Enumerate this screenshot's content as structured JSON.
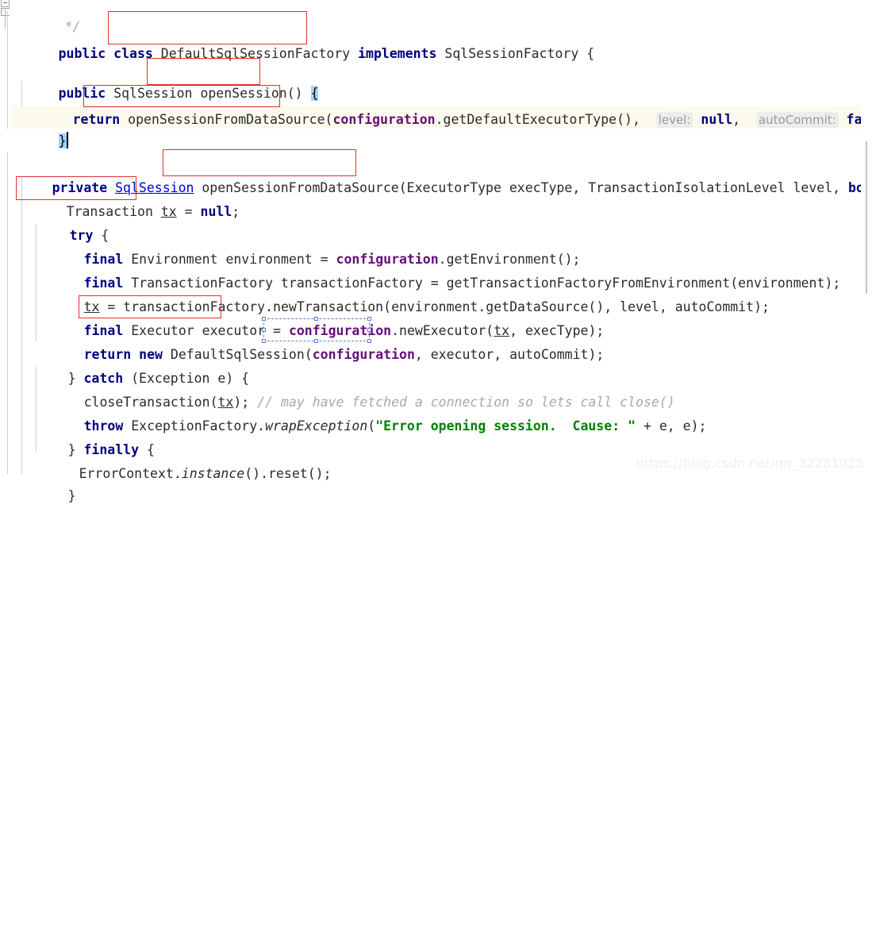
{
  "editor": {
    "language": "java",
    "colors": {
      "keyword": "#000080",
      "field": "#660e7a",
      "string": "#008000",
      "comment": "#a8a8a8",
      "link": "#0000d0",
      "annotation_box": "#e03030",
      "selection_box": "#5b7ed6",
      "text_selection": "#a6d2ff",
      "current_line": "#fcfaec",
      "hint_background": "#ededed",
      "hint_text": "#9a9a9a",
      "watermark": "#efefef",
      "background": "#ffffff"
    },
    "lines": [
      {
        "id": "l1",
        "text": "  */"
      },
      {
        "id": "l2",
        "text": "public class DefaultSqlSessionFactory implements SqlSessionFactory {"
      },
      {
        "id": "l3",
        "text": ""
      },
      {
        "id": "l4",
        "text": "public SqlSession openSession() {"
      },
      {
        "id": "l5",
        "text": "  return openSessionFromDataSource(configuration.getDefaultExecutorType(), level: null, autoCommit: false);"
      },
      {
        "id": "l6",
        "text": "}"
      },
      {
        "id": "l7",
        "text": ""
      },
      {
        "id": "l8",
        "text": "private SqlSession openSessionFromDataSource(ExecutorType execType, TransactionIsolationLevel level, boolean"
      },
      {
        "id": "l9",
        "text": "  Transaction tx = null;"
      },
      {
        "id": "l10",
        "text": "  try {"
      },
      {
        "id": "l11",
        "text": "    final Environment environment = configuration.getEnvironment();"
      },
      {
        "id": "l12",
        "text": "    final TransactionFactory transactionFactory = getTransactionFactoryFromEnvironment(environment);"
      },
      {
        "id": "l13",
        "text": "    tx = transactionFactory.newTransaction(environment.getDataSource(), level, autoCommit);"
      },
      {
        "id": "l14",
        "text": "    final Executor executor = configuration.newExecutor(tx, execType);"
      },
      {
        "id": "l15",
        "text": "    return new DefaultSqlSession(configuration, executor, autoCommit);"
      },
      {
        "id": "l16",
        "text": "  } catch (Exception e) {"
      },
      {
        "id": "l17",
        "text": "    closeTransaction(tx); // may have fetched a connection so lets call close()"
      },
      {
        "id": "l18",
        "text": "    throw ExceptionFactory.wrapException(\"Error opening session.  Cause: \" + e, e);"
      },
      {
        "id": "l19",
        "text": "  } finally {"
      },
      {
        "id": "l20",
        "text": "    ErrorContext.instance().reset();"
      },
      {
        "id": "l21",
        "text": "  }"
      }
    ],
    "tokens": {
      "kw_public": "public",
      "kw_class": "class",
      "kw_implements": "implements",
      "kw_private": "private",
      "kw_return": "return",
      "kw_new": "new",
      "kw_final": "final",
      "kw_try": "try",
      "kw_catch": "catch",
      "kw_finally": "finally",
      "kw_throw": "throw",
      "kw_boolean": "boolean",
      "kw_null": "null",
      "kw_false": "false",
      "type_default_factory": "DefaultSqlSessionFactory",
      "type_sql_session_factory": "SqlSessionFactory",
      "type_sql_session": "SqlSession",
      "type_transaction": "Transaction",
      "type_environment": "Environment",
      "type_transaction_factory": "TransactionFactory",
      "type_executor": "Executor",
      "type_default_sql_session": "DefaultSqlSession",
      "type_exception": "Exception",
      "type_executor_type": "ExecutorType",
      "type_isolation_level": "TransactionIsolationLevel",
      "type_exception_factory": "ExceptionFactory",
      "type_error_context": "ErrorContext",
      "m_open_session": "openSession()",
      "m_open_from_ds": "openSessionFromDataSource",
      "m_get_default_exec_type": "getDefaultExecutorType",
      "m_get_environment": "getEnvironment",
      "m_get_tf_from_env": "getTransactionFactoryFromEnvironment",
      "m_new_transaction": "newTransaction",
      "m_get_data_source": "getDataSource",
      "m_new_executor": "newExecutor",
      "m_close_transaction": "closeTransaction",
      "m_wrap_exception": "wrapException",
      "m_instance": "instance",
      "m_reset": "reset",
      "v_configuration": "configuration",
      "v_tx": "tx",
      "v_executor": "executor",
      "v_exec_type": "execType",
      "v_level": "level",
      "v_auto_commit": "autoCommit",
      "v_environment": "environment",
      "v_transaction_factory": "transactionFactory",
      "v_e": "e",
      "comment_close": "*/",
      "comment_close_tx": "// may have fetched a connection so lets call close()",
      "string_error": "\"Error opening session.  Cause: \""
    },
    "parameter_hints": [
      {
        "label": "level:",
        "value": "null"
      },
      {
        "label": "autoCommit:",
        "value": "false"
      }
    ],
    "annotations": {
      "red_boxes": [
        {
          "name": "class-name-box",
          "target": "DefaultSqlSessionFactory"
        },
        {
          "name": "open-session-method-box",
          "target": "openSession()"
        },
        {
          "name": "open-from-ds-call-box",
          "target": "openSessionFromDataSource"
        },
        {
          "name": "open-from-ds-decl-box",
          "target": "openSessionFromDataSource"
        },
        {
          "name": "transaction-tx-box",
          "target": "Transaction tx"
        },
        {
          "name": "executor-decl-box",
          "target": "Executor executor"
        }
      ],
      "selection_box": {
        "name": "configuration-selection",
        "target": "configuration"
      }
    },
    "caret_line": "l6",
    "selected_text": "}"
  },
  "watermark": {
    "text": "https://blog.csdn.net/qq_32281025"
  }
}
